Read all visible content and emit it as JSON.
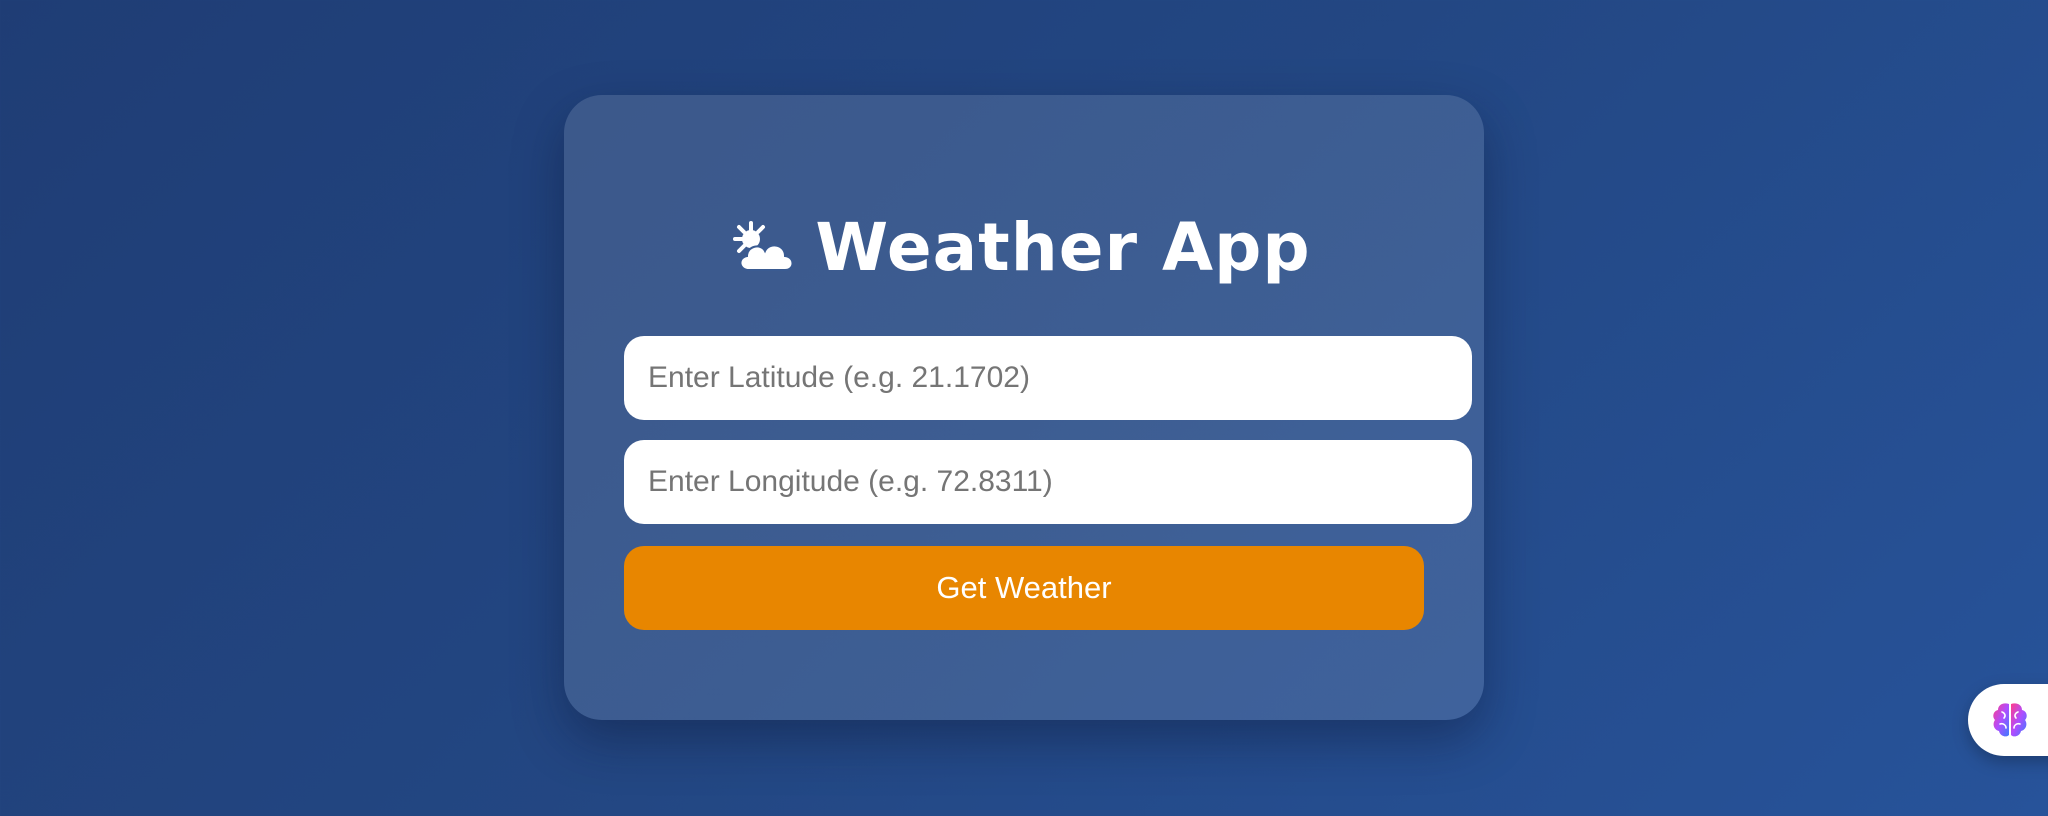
{
  "app": {
    "title": "Weather App",
    "title_icon": "sun-behind-cloud-icon"
  },
  "form": {
    "latitude_placeholder": "Enter Latitude (e.g. 21.1702)",
    "latitude_value": "",
    "longitude_placeholder": "Enter Longitude (e.g. 72.8311)",
    "longitude_value": "",
    "submit_label": "Get Weather"
  },
  "assistant": {
    "icon": "brain-icon"
  },
  "colors": {
    "background": "#234783",
    "button": "#e88600",
    "button_text": "#ffffff",
    "title_text": "#ffffff",
    "input_background": "#ffffff",
    "placeholder": "#757575"
  }
}
